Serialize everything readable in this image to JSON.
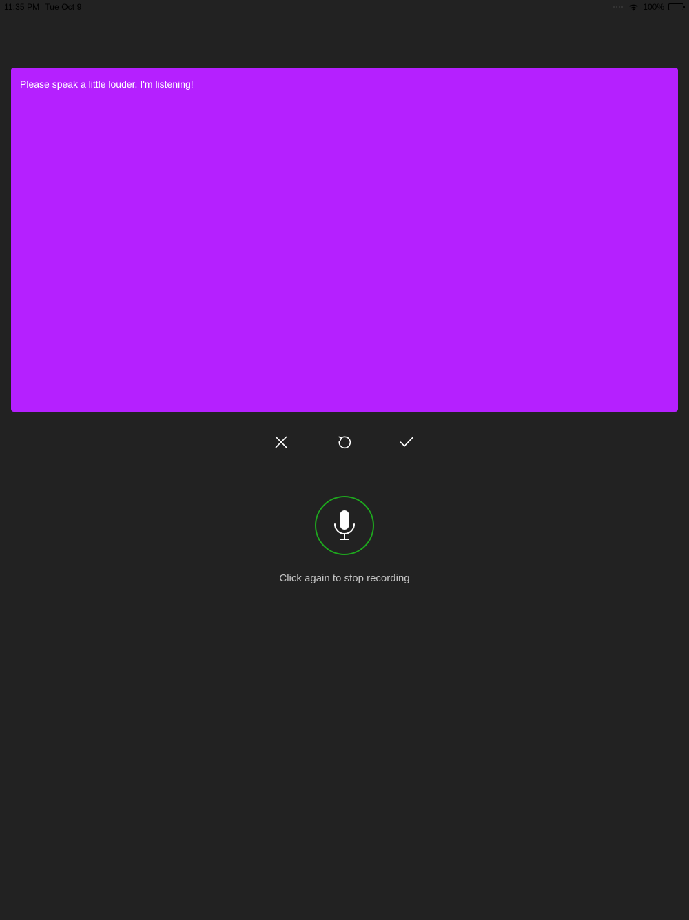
{
  "status_bar": {
    "time": "11:35 PM",
    "date": "Tue Oct 9",
    "battery_text": "100%",
    "icons": [
      "signal-dots-icon",
      "wifi-icon",
      "battery-icon"
    ]
  },
  "panel": {
    "transcript": "Please speak a little louder. I'm listening!",
    "background_color": "#b520ff"
  },
  "actions": [
    {
      "icon": "close-icon"
    },
    {
      "icon": "retry-icon"
    },
    {
      "icon": "checkmark-icon"
    }
  ],
  "mic": {
    "icon": "microphone-icon",
    "ring_color": "#1ea81e"
  },
  "hint": "Click again to stop recording",
  "colors": {
    "background": "#222222",
    "icon": "#ffffff",
    "hint_text": "#c4c4c4"
  }
}
